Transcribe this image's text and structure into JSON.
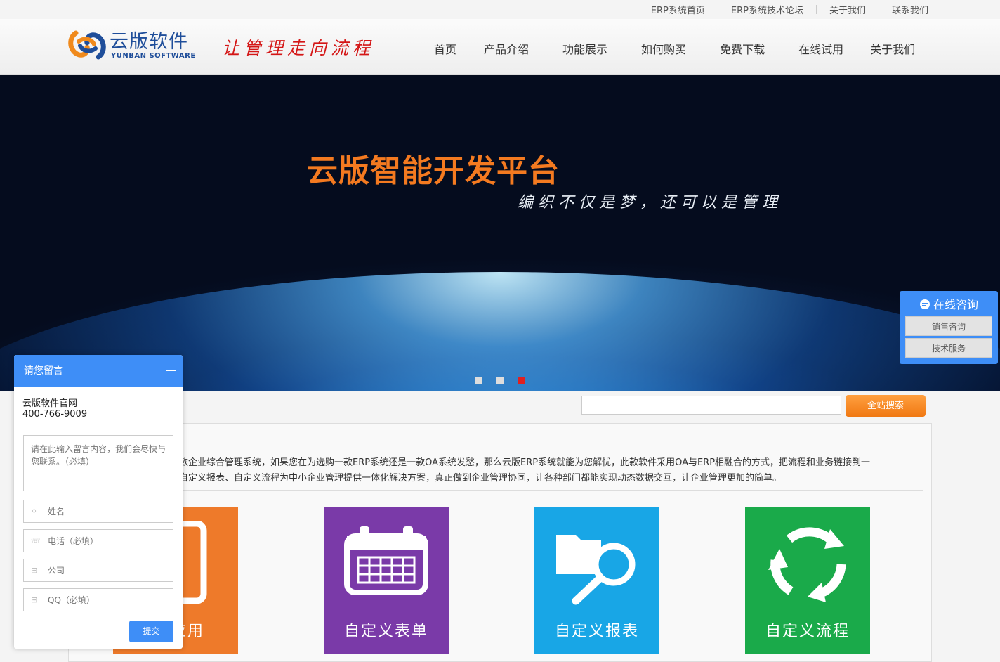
{
  "topbar": {
    "links": [
      "ERP系统首页",
      "ERP系统技术论坛",
      "关于我们",
      "联系我们"
    ]
  },
  "header": {
    "logo_cn": "云版软件",
    "logo_en": "YUNBAN SOFTWARE",
    "slogan": "让管理走向流程",
    "nav": [
      "首页",
      "产品介绍",
      "功能展示",
      "如何购买",
      "免费下载",
      "在线试用",
      "关于我们"
    ]
  },
  "banner": {
    "title": "云版智能开发平台",
    "subtitle": "编织不仅是梦，还可以是管理",
    "slides": 3,
    "active_slide": 3
  },
  "consult": {
    "title": "在线咨询",
    "sales": "销售咨询",
    "tech": "技术服务"
  },
  "search": {
    "button": "全站搜索",
    "value": ""
  },
  "intro": {
    "line1": "款企业综合管理系统，如果您在为选购一款ERP系统还是一款OA系统发愁，那么云版ERP系统就能为您解忧，此款软件采用OA与ERP相融合的方式，把流程和业务链接到一",
    "line2": "自定义报表、自定义流程为中小企业管理提供一体化解决方案，真正做到企业管理协同，让各种部门都能实现动态数据交互，让企业管理更加的简单。"
  },
  "tiles": [
    {
      "label": "应用",
      "color": "#ee7a2a",
      "icon": "tablet-icon"
    },
    {
      "label": "自定义表单",
      "color": "#7a3aa8",
      "icon": "calendar-icon"
    },
    {
      "label": "自定义报表",
      "color": "#18a6e6",
      "icon": "folder-search-icon"
    },
    {
      "label": "自定义流程",
      "color": "#1aaa4a",
      "icon": "recycle-icon"
    }
  ],
  "chat": {
    "title": "请您留言",
    "company": "云版软件官网",
    "phone": "400-766-9009",
    "message_placeholder": "请在此输入留言内容，我们会尽快与您联系。（必填）",
    "name_placeholder": "姓名",
    "tel_placeholder": "电话（必填）",
    "corp_placeholder": "公司",
    "qq_placeholder": "QQ（必填）",
    "submit": "提交"
  }
}
